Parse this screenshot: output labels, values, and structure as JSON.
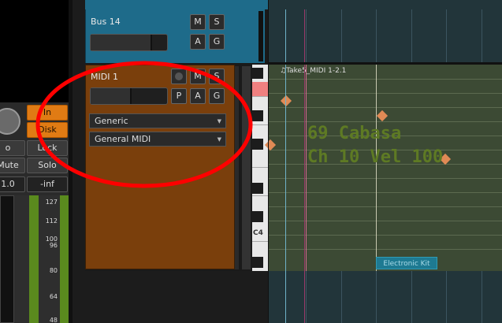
{
  "left_strip": {
    "in_label": "In",
    "disk_label": "Disk",
    "play_label": "o",
    "lock_label": "Lock",
    "mute_label": "Mute",
    "solo_label": "Solo",
    "gain_value": "1.0",
    "peak_value": "-inf",
    "scale": [
      "127",
      "112",
      "100",
      "96",
      "80",
      "64",
      "48"
    ]
  },
  "bus_track": {
    "name": "Bus 14",
    "m_label": "M",
    "s_label": "S",
    "a_label": "A",
    "g_label": "G"
  },
  "midi_track": {
    "name": "MIDI 1",
    "m_label": "M",
    "s_label": "S",
    "p_label": "P",
    "a_label": "A",
    "g_label": "G",
    "patch_selector": "Generic",
    "midi_mode": "General MIDI"
  },
  "timeline": {
    "region_name": "♫Take5_MIDI 1-2.1",
    "note_info_line1": "69 Cabasa",
    "note_info_line2": "Ch 10 Vel 100",
    "mini_region_label": "Electronic Kit",
    "keyboard_label": "C4"
  },
  "annotation": {
    "color": "#ff0000",
    "shape": "ellipse"
  },
  "colors": {
    "bus_track": "#1e6b8a",
    "midi_track": "#7a3f0c",
    "record_orange": "#e07b14",
    "note": "#e08a55",
    "overlay_text": "#5e7a24"
  }
}
